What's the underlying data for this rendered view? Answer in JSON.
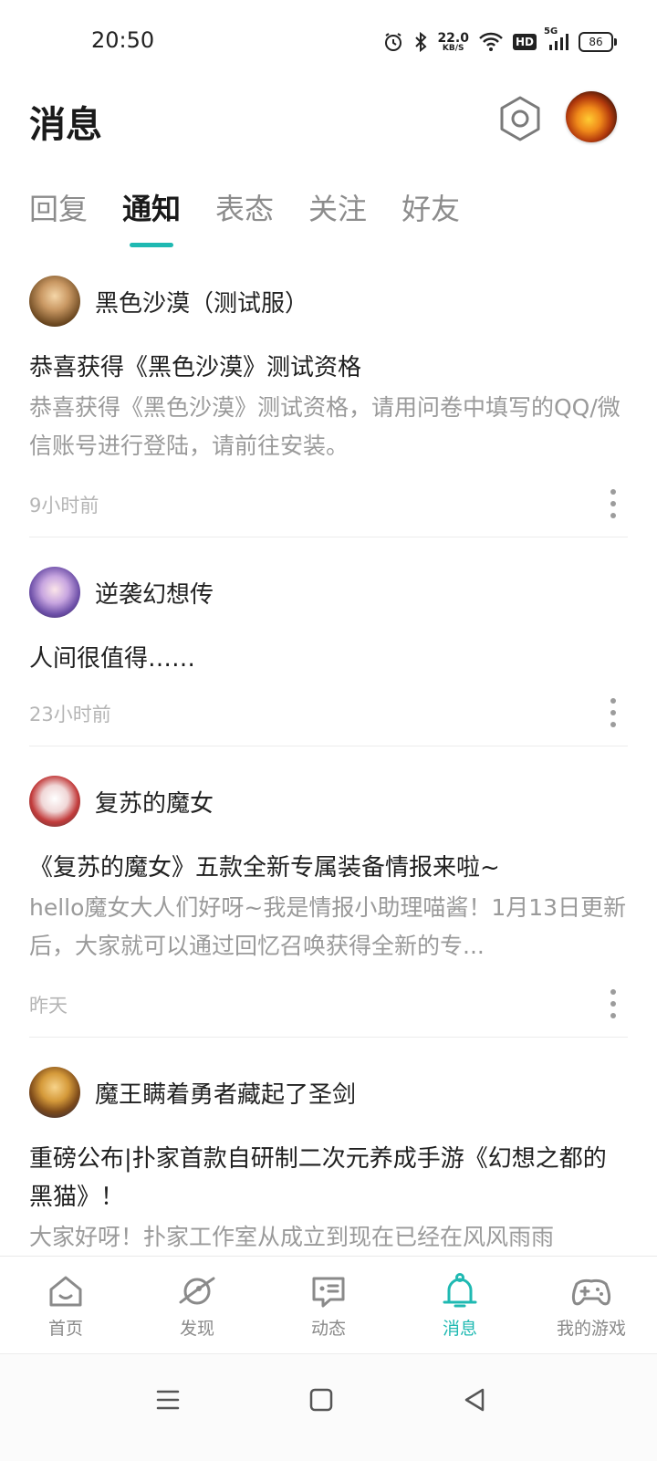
{
  "status_bar": {
    "time": "20:50",
    "net_speed_value": "22.0",
    "net_speed_unit": "KB/S",
    "hd_label": "HD",
    "network_label": "5G",
    "battery": "86"
  },
  "header": {
    "title": "消息"
  },
  "tabs": [
    {
      "label": "回复",
      "active": false
    },
    {
      "label": "通知",
      "active": true
    },
    {
      "label": "表态",
      "active": false
    },
    {
      "label": "关注",
      "active": false
    },
    {
      "label": "好友",
      "active": false
    }
  ],
  "notifications": [
    {
      "name": "黑色沙漠（测试服）",
      "title": "恭喜获得《黑色沙漠》测试资格",
      "body": "恭喜获得《黑色沙漠》测试资格，请用问卷中填写的QQ/微信账号进行登陆，请前往安装。",
      "time": "9小时前"
    },
    {
      "name": "逆袭幻想传",
      "title": "人间很值得……",
      "body": "",
      "time": "23小时前"
    },
    {
      "name": "复苏的魔女",
      "title": "《复苏的魔女》五款全新专属装备情报来啦~",
      "body": "hello魔女大人们好呀~我是情报小助理喵酱！1月13日更新后，大家就可以通过回忆召唤获得全新的专...",
      "time": "昨天"
    },
    {
      "name": "魔王瞒着勇者藏起了圣剑",
      "title": "重磅公布|扑家首款自研制二次元养成手游《幻想之都的黑猫》！",
      "body": "大家好呀！扑家工作室从成立到现在已经在风风雨雨",
      "time": ""
    }
  ],
  "bottom_nav": [
    {
      "label": "首页",
      "icon": "home-icon",
      "active": false
    },
    {
      "label": "发现",
      "icon": "planet-icon",
      "active": false
    },
    {
      "label": "动态",
      "icon": "chat-icon",
      "active": false
    },
    {
      "label": "消息",
      "icon": "bell-icon",
      "active": true
    },
    {
      "label": "我的游戏",
      "icon": "gamepad-icon",
      "active": false
    }
  ],
  "colors": {
    "accent": "#1fb9b2",
    "text_primary": "#1f1f1f",
    "text_secondary": "#9a9a9a"
  }
}
